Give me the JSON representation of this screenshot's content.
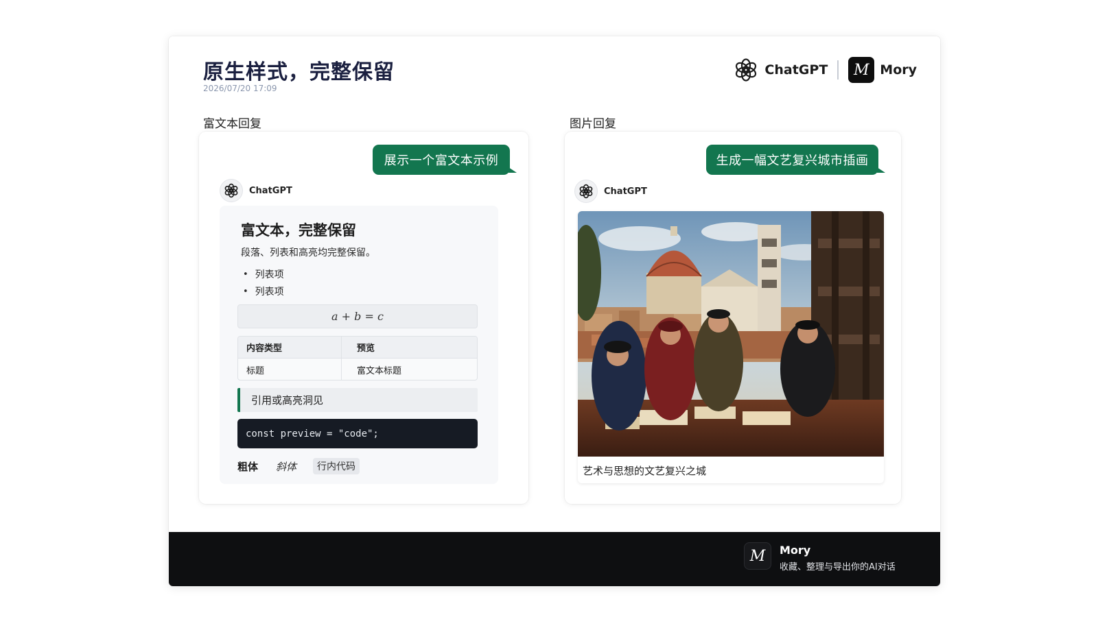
{
  "header": {
    "title": "原生样式，完整保留",
    "timestamp": "2026/07/20 17:09",
    "brand_chatgpt": "ChatGPT",
    "brand_mory": "Mory",
    "mory_logo_glyph": "M"
  },
  "left": {
    "section_label": "富文本回复",
    "user_message": "展示一个富文本示例",
    "assistant_name": "ChatGPT",
    "rich": {
      "heading": "富文本，完整保留",
      "paragraph": "段落、列表和高亮均完整保留。",
      "list": [
        "列表项",
        "列表项"
      ],
      "math": "a + b = c",
      "table": {
        "headers": [
          "内容类型",
          "预览"
        ],
        "rows": [
          [
            "标题",
            "富文本标题"
          ]
        ]
      },
      "quote": "引用或高亮洞见",
      "code": "const preview = \"code\";",
      "bold": "粗体",
      "italic": "斜体",
      "inline_code": "行内代码"
    }
  },
  "right": {
    "section_label": "图片回复",
    "user_message": "生成一幅文艺复兴城市插画",
    "assistant_name": "ChatGPT",
    "image_caption": "艺术与思想的文艺复兴之城"
  },
  "footer": {
    "name": "Mory",
    "tagline": "收藏、整理与导出你的AI对话",
    "logo_glyph": "M"
  },
  "colors": {
    "accent_green": "#13764f",
    "footer_bg": "#0e0f11",
    "title_navy": "#1b2040"
  },
  "icons": [
    "openai-logo-icon",
    "mory-logo-icon"
  ]
}
